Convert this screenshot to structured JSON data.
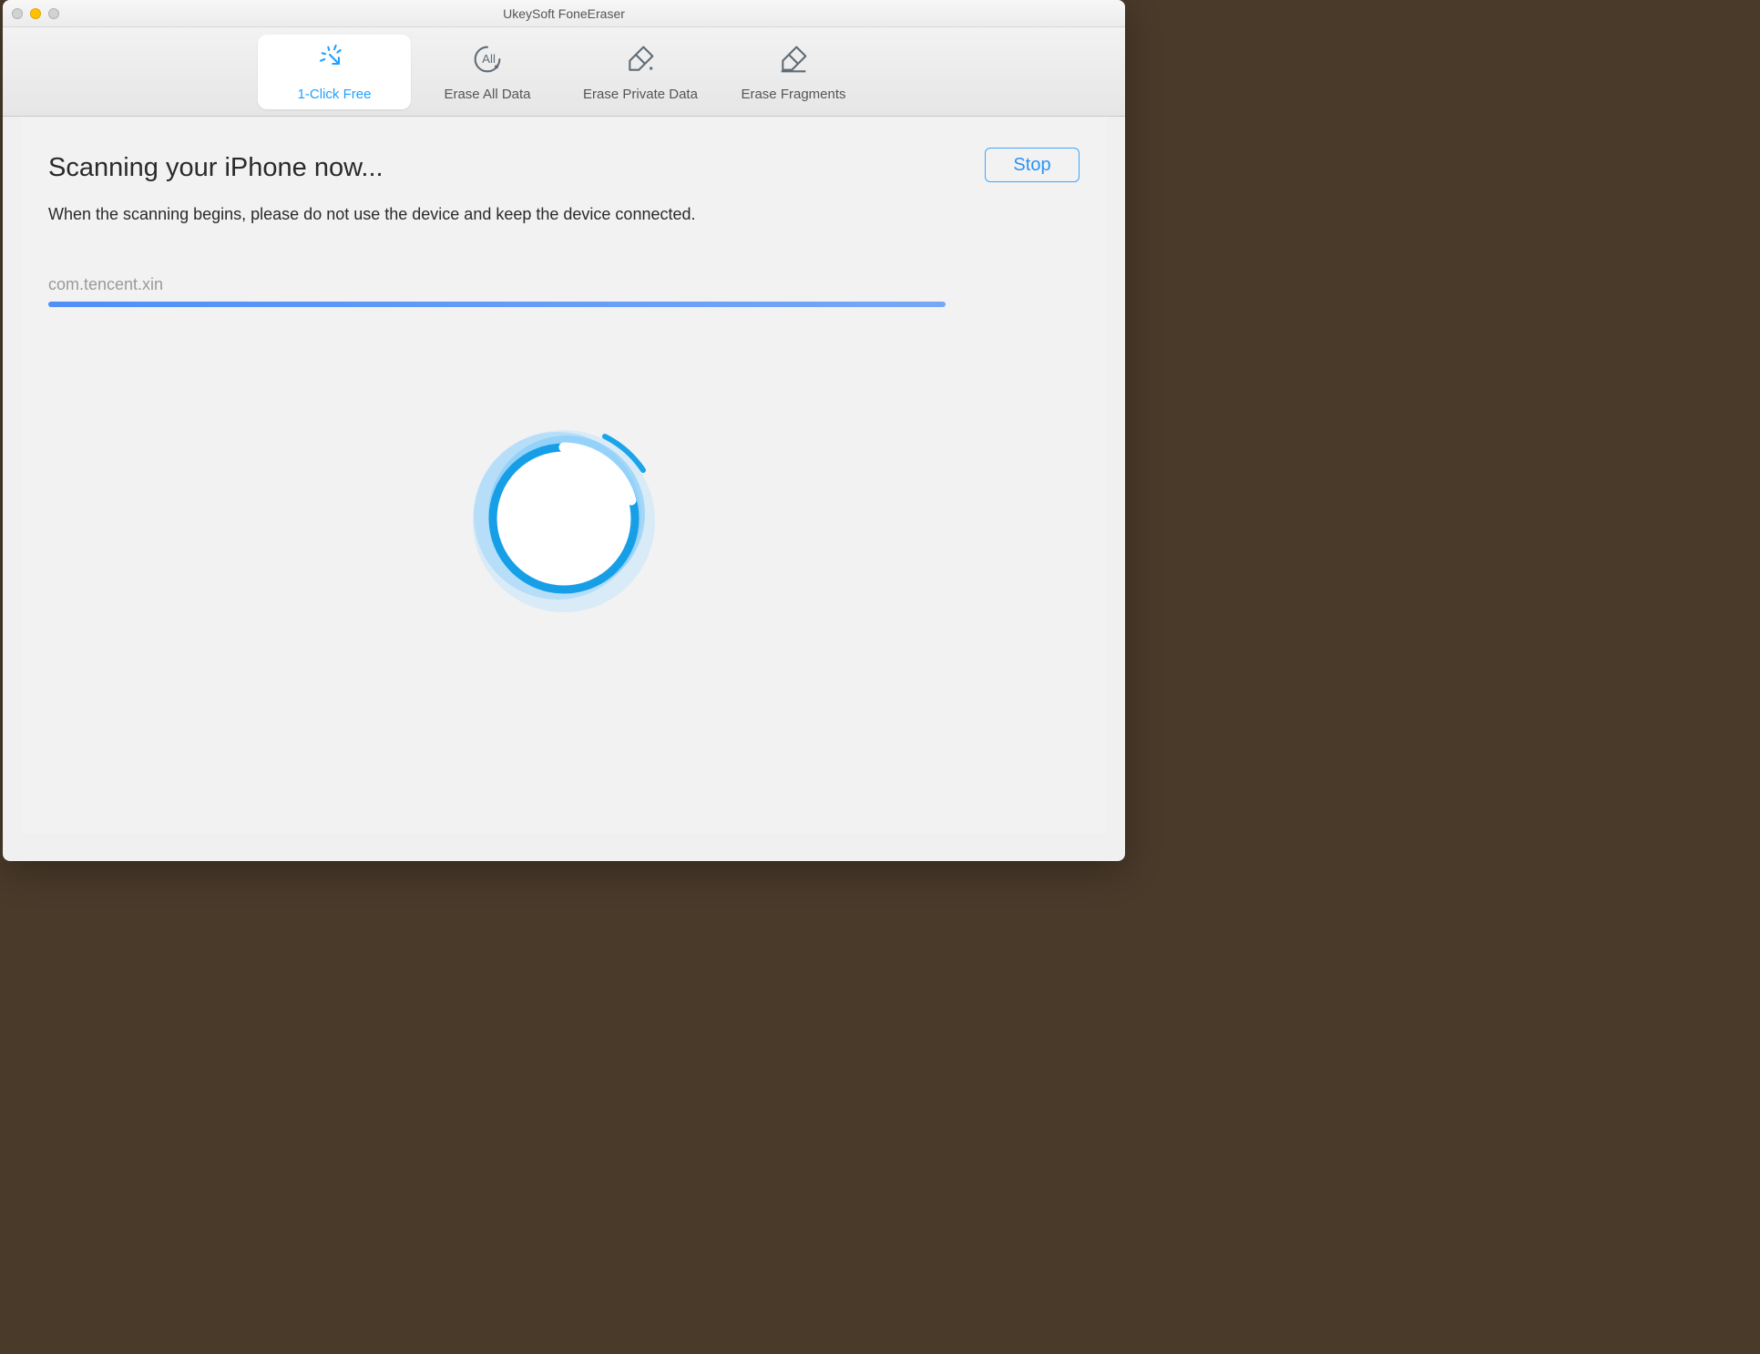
{
  "window": {
    "title": "UkeySoft FoneEraser"
  },
  "tabs": [
    {
      "label": "1-Click Free",
      "active": true
    },
    {
      "label": "Erase All Data",
      "active": false
    },
    {
      "label": "Erase Private Data",
      "active": false
    },
    {
      "label": "Erase Fragments",
      "active": false
    }
  ],
  "main": {
    "heading": "Scanning your iPhone now...",
    "subheading": "When the scanning begins, please do not use the device and keep the device connected.",
    "current_item": "com.tencent.xin",
    "progress_percent": 87,
    "stop_label": "Stop"
  }
}
